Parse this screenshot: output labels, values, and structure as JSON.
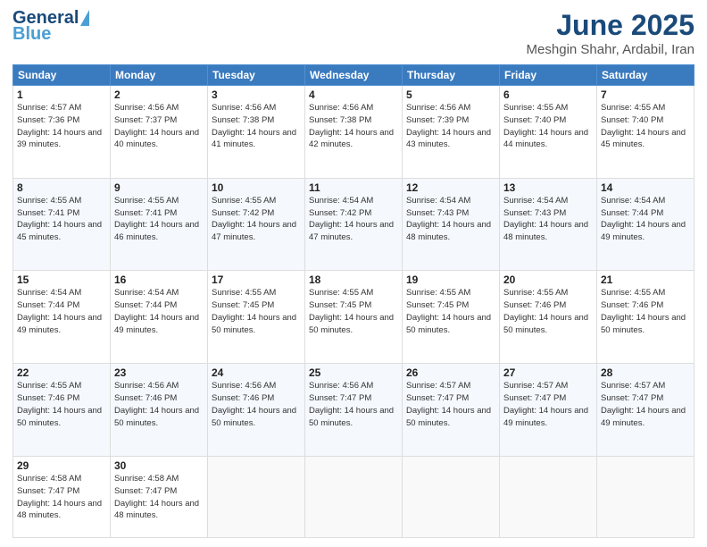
{
  "header": {
    "logo_line1": "General",
    "logo_line2": "Blue",
    "main_title": "June 2025",
    "subtitle": "Meshgin Shahr, Ardabil, Iran"
  },
  "weekdays": [
    "Sunday",
    "Monday",
    "Tuesday",
    "Wednesday",
    "Thursday",
    "Friday",
    "Saturday"
  ],
  "weeks": [
    [
      {
        "day": "1",
        "sunrise": "4:57 AM",
        "sunset": "7:36 PM",
        "daylight": "14 hours and 39 minutes."
      },
      {
        "day": "2",
        "sunrise": "4:56 AM",
        "sunset": "7:37 PM",
        "daylight": "14 hours and 40 minutes."
      },
      {
        "day": "3",
        "sunrise": "4:56 AM",
        "sunset": "7:38 PM",
        "daylight": "14 hours and 41 minutes."
      },
      {
        "day": "4",
        "sunrise": "4:56 AM",
        "sunset": "7:38 PM",
        "daylight": "14 hours and 42 minutes."
      },
      {
        "day": "5",
        "sunrise": "4:56 AM",
        "sunset": "7:39 PM",
        "daylight": "14 hours and 43 minutes."
      },
      {
        "day": "6",
        "sunrise": "4:55 AM",
        "sunset": "7:40 PM",
        "daylight": "14 hours and 44 minutes."
      },
      {
        "day": "7",
        "sunrise": "4:55 AM",
        "sunset": "7:40 PM",
        "daylight": "14 hours and 45 minutes."
      }
    ],
    [
      {
        "day": "8",
        "sunrise": "4:55 AM",
        "sunset": "7:41 PM",
        "daylight": "14 hours and 45 minutes."
      },
      {
        "day": "9",
        "sunrise": "4:55 AM",
        "sunset": "7:41 PM",
        "daylight": "14 hours and 46 minutes."
      },
      {
        "day": "10",
        "sunrise": "4:55 AM",
        "sunset": "7:42 PM",
        "daylight": "14 hours and 47 minutes."
      },
      {
        "day": "11",
        "sunrise": "4:54 AM",
        "sunset": "7:42 PM",
        "daylight": "14 hours and 47 minutes."
      },
      {
        "day": "12",
        "sunrise": "4:54 AM",
        "sunset": "7:43 PM",
        "daylight": "14 hours and 48 minutes."
      },
      {
        "day": "13",
        "sunrise": "4:54 AM",
        "sunset": "7:43 PM",
        "daylight": "14 hours and 48 minutes."
      },
      {
        "day": "14",
        "sunrise": "4:54 AM",
        "sunset": "7:44 PM",
        "daylight": "14 hours and 49 minutes."
      }
    ],
    [
      {
        "day": "15",
        "sunrise": "4:54 AM",
        "sunset": "7:44 PM",
        "daylight": "14 hours and 49 minutes."
      },
      {
        "day": "16",
        "sunrise": "4:54 AM",
        "sunset": "7:44 PM",
        "daylight": "14 hours and 49 minutes."
      },
      {
        "day": "17",
        "sunrise": "4:55 AM",
        "sunset": "7:45 PM",
        "daylight": "14 hours and 50 minutes."
      },
      {
        "day": "18",
        "sunrise": "4:55 AM",
        "sunset": "7:45 PM",
        "daylight": "14 hours and 50 minutes."
      },
      {
        "day": "19",
        "sunrise": "4:55 AM",
        "sunset": "7:45 PM",
        "daylight": "14 hours and 50 minutes."
      },
      {
        "day": "20",
        "sunrise": "4:55 AM",
        "sunset": "7:46 PM",
        "daylight": "14 hours and 50 minutes."
      },
      {
        "day": "21",
        "sunrise": "4:55 AM",
        "sunset": "7:46 PM",
        "daylight": "14 hours and 50 minutes."
      }
    ],
    [
      {
        "day": "22",
        "sunrise": "4:55 AM",
        "sunset": "7:46 PM",
        "daylight": "14 hours and 50 minutes."
      },
      {
        "day": "23",
        "sunrise": "4:56 AM",
        "sunset": "7:46 PM",
        "daylight": "14 hours and 50 minutes."
      },
      {
        "day": "24",
        "sunrise": "4:56 AM",
        "sunset": "7:46 PM",
        "daylight": "14 hours and 50 minutes."
      },
      {
        "day": "25",
        "sunrise": "4:56 AM",
        "sunset": "7:47 PM",
        "daylight": "14 hours and 50 minutes."
      },
      {
        "day": "26",
        "sunrise": "4:57 AM",
        "sunset": "7:47 PM",
        "daylight": "14 hours and 50 minutes."
      },
      {
        "day": "27",
        "sunrise": "4:57 AM",
        "sunset": "7:47 PM",
        "daylight": "14 hours and 49 minutes."
      },
      {
        "day": "28",
        "sunrise": "4:57 AM",
        "sunset": "7:47 PM",
        "daylight": "14 hours and 49 minutes."
      }
    ],
    [
      {
        "day": "29",
        "sunrise": "4:58 AM",
        "sunset": "7:47 PM",
        "daylight": "14 hours and 48 minutes."
      },
      {
        "day": "30",
        "sunrise": "4:58 AM",
        "sunset": "7:47 PM",
        "daylight": "14 hours and 48 minutes."
      },
      null,
      null,
      null,
      null,
      null
    ]
  ]
}
